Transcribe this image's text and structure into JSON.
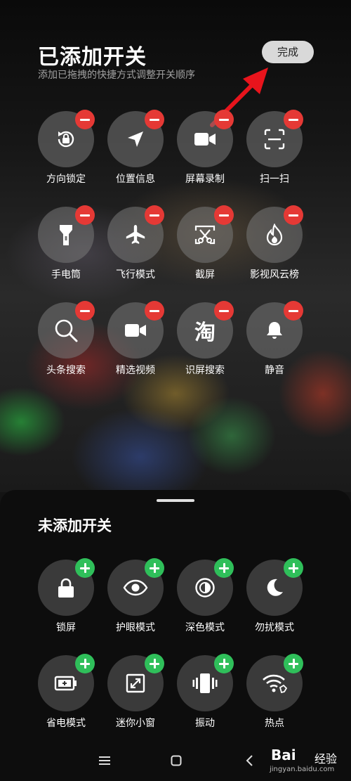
{
  "header": {
    "title": "已添加开关",
    "subtitle": "添加已拖拽的快捷方式调整开关顺序",
    "done_label": "完成"
  },
  "added": [
    {
      "label": "方向锁定",
      "icon": "rotation-lock-icon"
    },
    {
      "label": "位置信息",
      "icon": "location-arrow-icon"
    },
    {
      "label": "屏幕录制",
      "icon": "video-camera-icon"
    },
    {
      "label": "扫一扫",
      "icon": "scan-icon"
    },
    {
      "label": "手电筒",
      "icon": "flashlight-icon"
    },
    {
      "label": "飞行模式",
      "icon": "airplane-icon"
    },
    {
      "label": "截屏",
      "icon": "screenshot-scissors-icon"
    },
    {
      "label": "影视风云榜",
      "icon": "flame-icon"
    },
    {
      "label": "头条搜索",
      "icon": "search-icon"
    },
    {
      "label": "精选视频",
      "icon": "video-camera-icon"
    },
    {
      "label": "识屏搜索",
      "icon": "taobao-icon",
      "glyph": "淘"
    },
    {
      "label": "静音",
      "icon": "bell-icon"
    }
  ],
  "not_added": {
    "title": "未添加开关",
    "items": [
      {
        "label": "锁屏",
        "icon": "lock-icon"
      },
      {
        "label": "护眼模式",
        "icon": "eye-icon"
      },
      {
        "label": "深色模式",
        "icon": "dark-mode-icon"
      },
      {
        "label": "勿扰模式",
        "icon": "moon-icon"
      },
      {
        "label": "省电模式",
        "icon": "battery-saver-icon"
      },
      {
        "label": "迷你小窗",
        "icon": "mini-window-icon"
      },
      {
        "label": "振动",
        "icon": "vibrate-icon"
      },
      {
        "label": "热点",
        "icon": "hotspot-icon"
      }
    ]
  },
  "watermark": {
    "brand": "Bai",
    "brand_cn": "经验",
    "url": "jingyan.baidu.com"
  },
  "colors": {
    "remove_badge": "#e53935",
    "add_badge": "#2fbf5a",
    "arrow": "#e8141c"
  }
}
